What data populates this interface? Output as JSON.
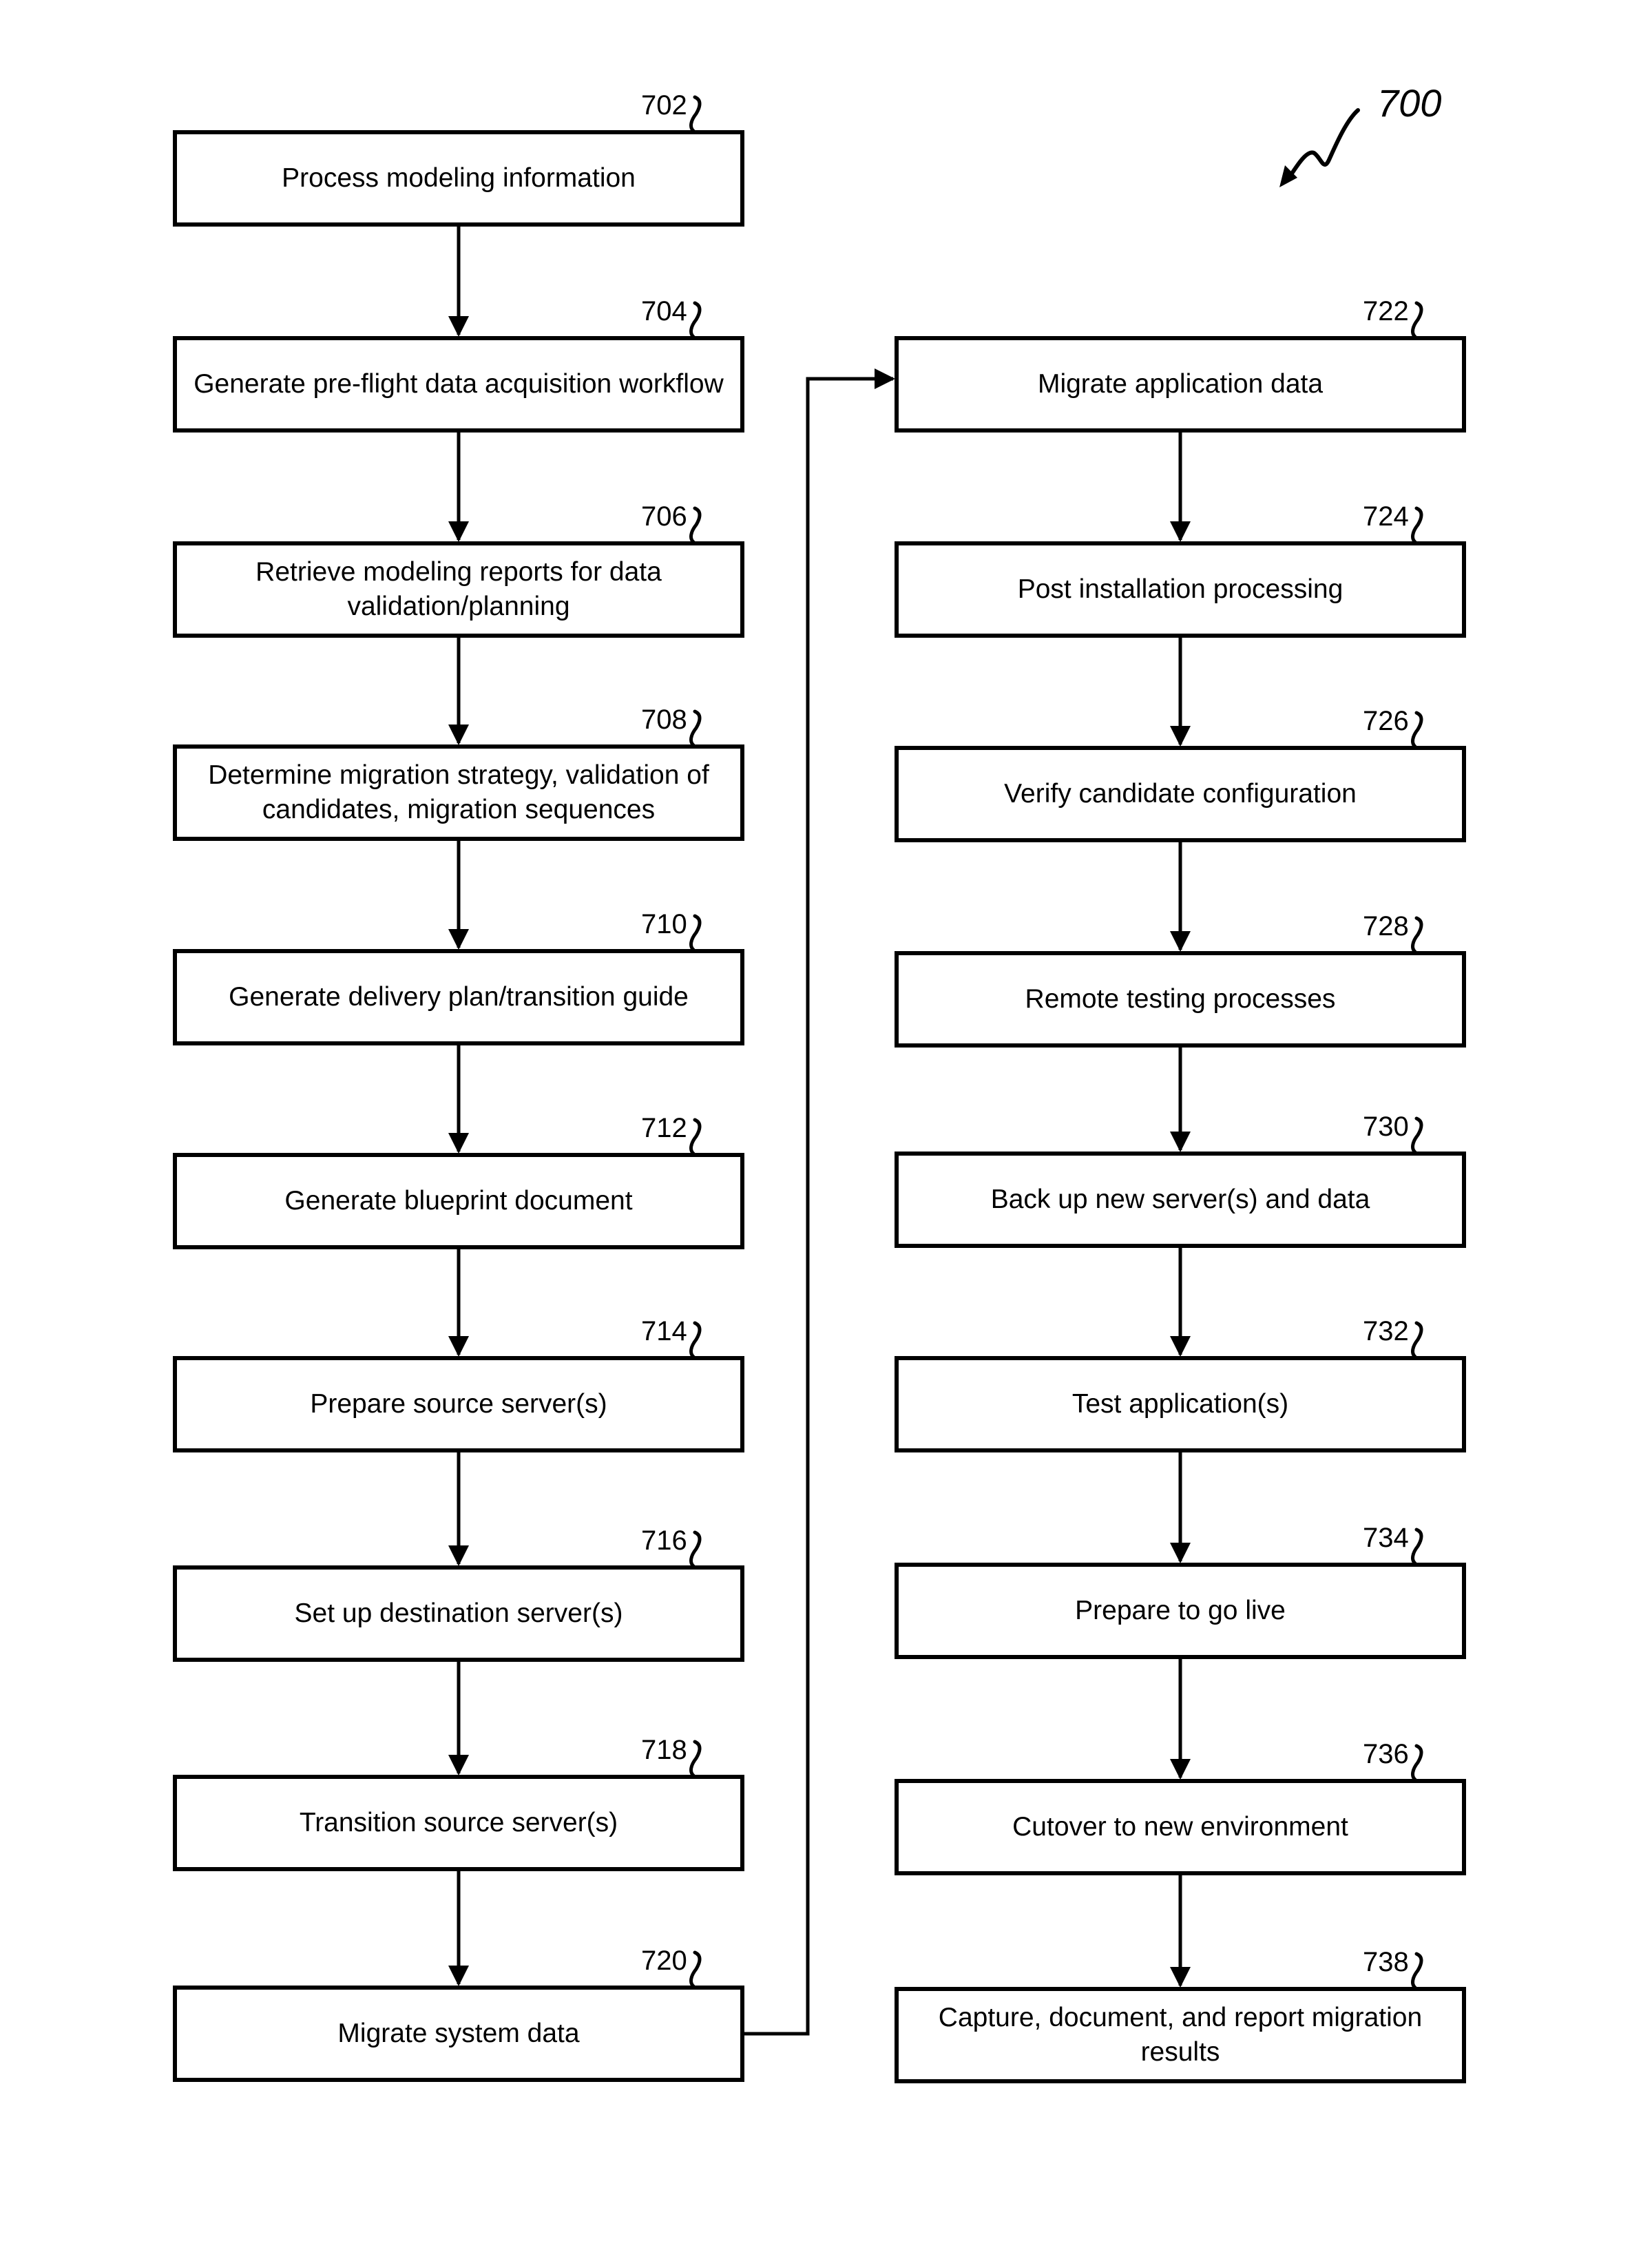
{
  "figure": {
    "reference": "700"
  },
  "steps": [
    {
      "ref": "702",
      "label": "Process modeling information"
    },
    {
      "ref": "704",
      "label": "Generate pre-flight data acquisition workflow"
    },
    {
      "ref": "706",
      "label": "Retrieve modeling reports for data validation/planning"
    },
    {
      "ref": "708",
      "label": "Determine migration strategy, validation of candidates, migration sequences"
    },
    {
      "ref": "710",
      "label": "Generate delivery plan/transition guide"
    },
    {
      "ref": "712",
      "label": "Generate blueprint document"
    },
    {
      "ref": "714",
      "label": "Prepare source server(s)"
    },
    {
      "ref": "716",
      "label": "Set up destination server(s)"
    },
    {
      "ref": "718",
      "label": "Transition source server(s)"
    },
    {
      "ref": "720",
      "label": "Migrate system data"
    },
    {
      "ref": "722",
      "label": "Migrate application data"
    },
    {
      "ref": "724",
      "label": "Post installation processing"
    },
    {
      "ref": "726",
      "label": "Verify candidate configuration"
    },
    {
      "ref": "728",
      "label": "Remote testing processes"
    },
    {
      "ref": "730",
      "label": "Back up new server(s) and data"
    },
    {
      "ref": "732",
      "label": "Test application(s)"
    },
    {
      "ref": "734",
      "label": "Prepare to go live"
    },
    {
      "ref": "736",
      "label": "Cutover to new environment"
    },
    {
      "ref": "738",
      "label": "Capture, document, and report migration results"
    }
  ],
  "flow": [
    [
      "702",
      "704"
    ],
    [
      "704",
      "706"
    ],
    [
      "706",
      "708"
    ],
    [
      "708",
      "710"
    ],
    [
      "710",
      "712"
    ],
    [
      "712",
      "714"
    ],
    [
      "714",
      "716"
    ],
    [
      "716",
      "718"
    ],
    [
      "718",
      "720"
    ],
    [
      "720",
      "722"
    ],
    [
      "722",
      "724"
    ],
    [
      "724",
      "726"
    ],
    [
      "726",
      "728"
    ],
    [
      "728",
      "730"
    ],
    [
      "730",
      "732"
    ],
    [
      "732",
      "734"
    ],
    [
      "734",
      "736"
    ],
    [
      "736",
      "738"
    ]
  ],
  "colors": {
    "stroke": "#000000",
    "background": "#ffffff"
  }
}
